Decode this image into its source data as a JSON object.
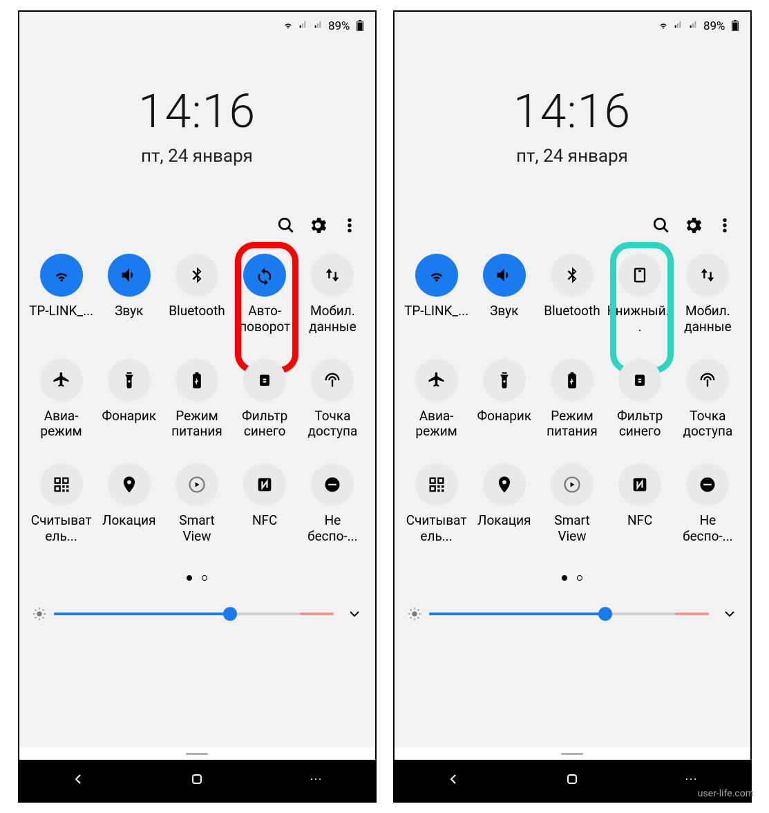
{
  "status": {
    "battery": "89%"
  },
  "clock": "14:16",
  "date": "пт, 24 января",
  "watermark": "user-life.com",
  "screens": [
    {
      "highlight_index": 3,
      "highlight_color": "red",
      "tiles": [
        {
          "label": "TP-LINK_...",
          "icon": "wifi",
          "on": true
        },
        {
          "label": "Звук",
          "icon": "sound",
          "on": true
        },
        {
          "label": "Bluetooth",
          "icon": "bluetooth",
          "on": false
        },
        {
          "label": "Авто-поворот",
          "icon": "autorotate",
          "on": true
        },
        {
          "label": "Мобил. данные",
          "icon": "data",
          "on": false
        },
        {
          "label": "Авиа-режим",
          "icon": "airplane",
          "on": false
        },
        {
          "label": "Фонарик",
          "icon": "flashlight",
          "on": false
        },
        {
          "label": "Режим питания",
          "icon": "battery",
          "on": false
        },
        {
          "label": "Фильтр синего",
          "icon": "bluefilter",
          "on": false
        },
        {
          "label": "Точка доступа",
          "icon": "hotspot",
          "on": false
        },
        {
          "label": "Считыватель...",
          "icon": "qr",
          "on": false
        },
        {
          "label": "Локация",
          "icon": "location",
          "on": false
        },
        {
          "label": "Smart View",
          "icon": "smartview",
          "on": false
        },
        {
          "label": "NFC",
          "icon": "nfc",
          "on": false
        },
        {
          "label": "Не беспо-...",
          "icon": "dnd",
          "on": false
        }
      ]
    },
    {
      "highlight_index": 3,
      "highlight_color": "teal",
      "tiles": [
        {
          "label": "TP-LINK_...",
          "icon": "wifi",
          "on": true
        },
        {
          "label": "Звук",
          "icon": "sound",
          "on": true
        },
        {
          "label": "Bluetooth",
          "icon": "bluetooth",
          "on": false
        },
        {
          "label": "Книжный...",
          "icon": "portrait",
          "on": false
        },
        {
          "label": "Мобил. данные",
          "icon": "data",
          "on": false
        },
        {
          "label": "Авиа-режим",
          "icon": "airplane",
          "on": false
        },
        {
          "label": "Фонарик",
          "icon": "flashlight",
          "on": false
        },
        {
          "label": "Режим питания",
          "icon": "battery",
          "on": false
        },
        {
          "label": "Фильтр синего",
          "icon": "bluefilter",
          "on": false
        },
        {
          "label": "Точка доступа",
          "icon": "hotspot",
          "on": false
        },
        {
          "label": "Считыватель...",
          "icon": "qr",
          "on": false
        },
        {
          "label": "Локация",
          "icon": "location",
          "on": false
        },
        {
          "label": "Smart View",
          "icon": "smartview",
          "on": false
        },
        {
          "label": "NFC",
          "icon": "nfc",
          "on": false
        },
        {
          "label": "Не беспо-...",
          "icon": "dnd",
          "on": false
        }
      ]
    }
  ]
}
